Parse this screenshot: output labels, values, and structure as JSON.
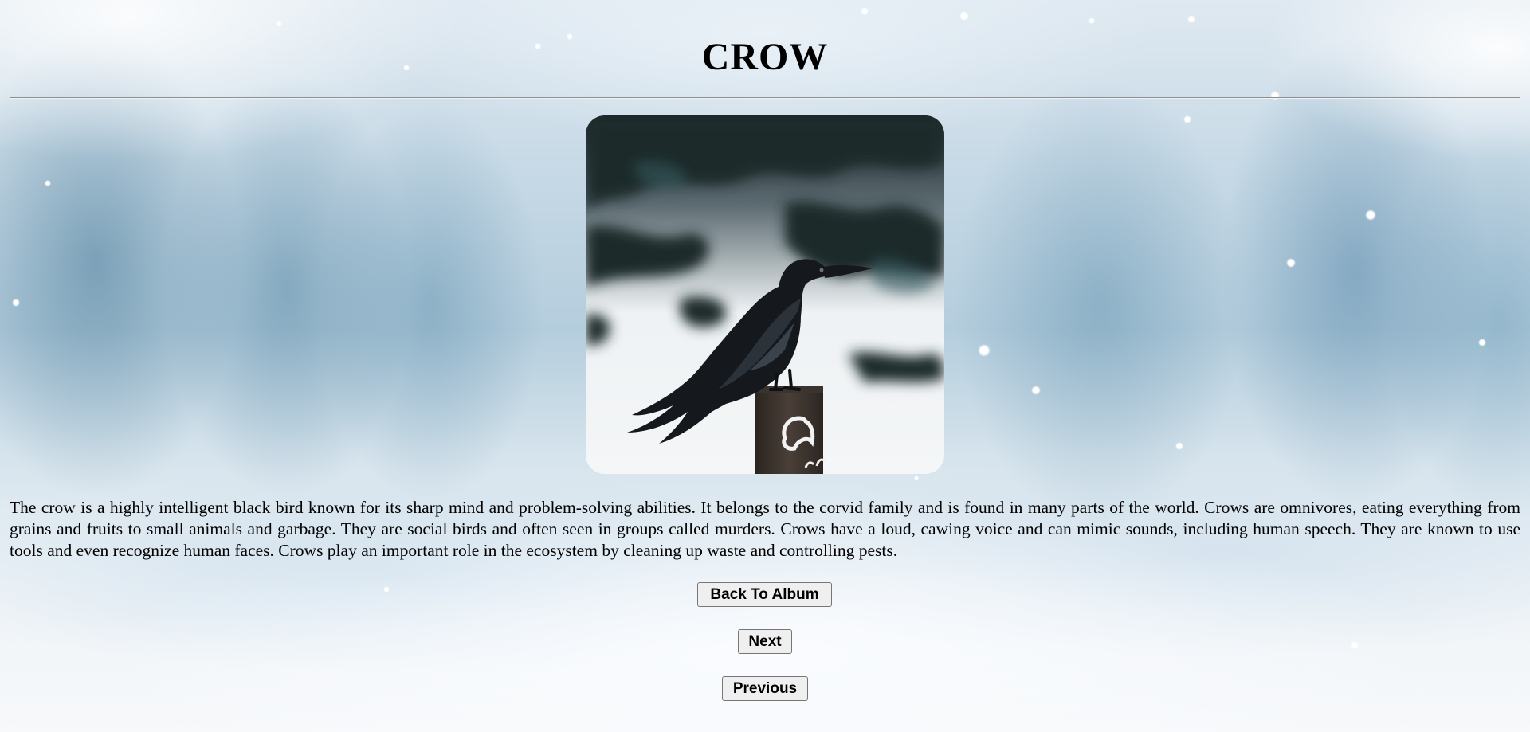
{
  "page": {
    "title": "CROW",
    "image_alt": "Crow perched on a wooden post in snow",
    "description": "The crow is a highly intelligent black bird known for its sharp mind and problem-solving abilities. It belongs to the corvid family and is found in many parts of the world. Crows are omnivores, eating everything from grains and fruits to small animals and garbage. They are social birds and often seen in groups called murders. Crows have a loud, cawing voice and can mimic sounds, including human speech. They are known to use tools and even recognize human faces. Crows play an important role in the ecosystem by cleaning up waste and controlling pests."
  },
  "buttons": {
    "back_label": "Back To Album",
    "next_label": "Next",
    "previous_label": "Previous"
  },
  "theme": {
    "background": "snowy-forest",
    "button_bg": "#efefef",
    "button_border": "#767676"
  }
}
